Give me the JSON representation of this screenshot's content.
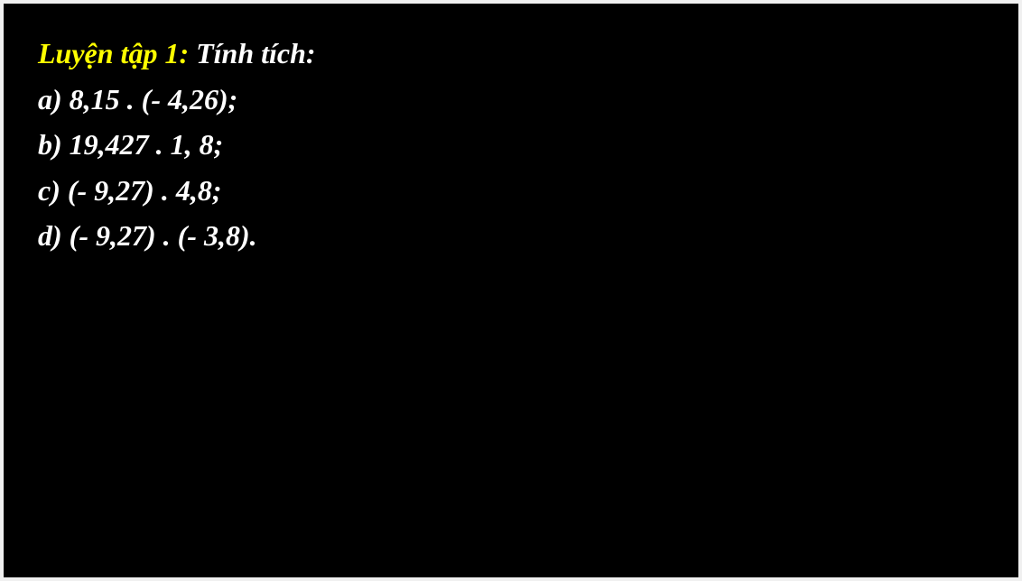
{
  "slide": {
    "title_label": "Luyện tập 1:",
    "title_text": " Tính tích:",
    "items": [
      "a) 8,15 . (- 4,26);",
      "b) 19,427 . 1, 8;",
      "c) (- 9,27) . 4,8;",
      "d) (- 9,27) . (- 3,8)."
    ]
  }
}
